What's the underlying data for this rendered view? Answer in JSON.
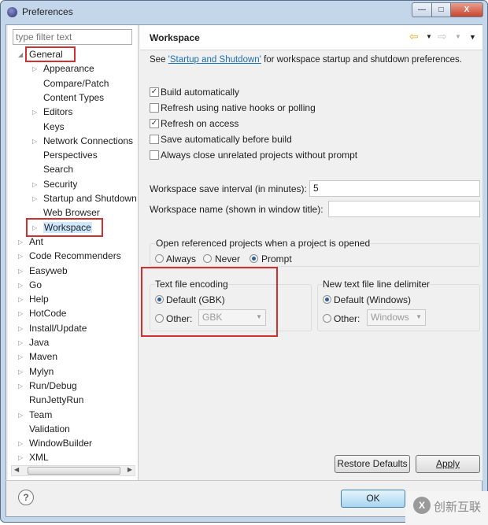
{
  "window": {
    "title": "Preferences",
    "minimize": "—",
    "maximize": "□",
    "close": "X"
  },
  "filter": {
    "placeholder": "type filter text"
  },
  "tree": [
    {
      "label": "General",
      "indent": 1,
      "arrow": "expanded"
    },
    {
      "label": "Appearance",
      "indent": 2,
      "arrow": "collapsed"
    },
    {
      "label": "Compare/Patch",
      "indent": 2,
      "arrow": "none"
    },
    {
      "label": "Content Types",
      "indent": 2,
      "arrow": "none"
    },
    {
      "label": "Editors",
      "indent": 2,
      "arrow": "collapsed"
    },
    {
      "label": "Keys",
      "indent": 2,
      "arrow": "none"
    },
    {
      "label": "Network Connections",
      "indent": 2,
      "arrow": "collapsed"
    },
    {
      "label": "Perspectives",
      "indent": 2,
      "arrow": "none"
    },
    {
      "label": "Search",
      "indent": 2,
      "arrow": "none"
    },
    {
      "label": "Security",
      "indent": 2,
      "arrow": "collapsed"
    },
    {
      "label": "Startup and Shutdown",
      "indent": 2,
      "arrow": "collapsed"
    },
    {
      "label": "Web Browser",
      "indent": 2,
      "arrow": "none"
    },
    {
      "label": "Workspace",
      "indent": 2,
      "arrow": "collapsed",
      "selected": true
    },
    {
      "label": "Ant",
      "indent": 1,
      "arrow": "collapsed"
    },
    {
      "label": "Code Recommenders",
      "indent": 1,
      "arrow": "collapsed"
    },
    {
      "label": "Easyweb",
      "indent": 1,
      "arrow": "collapsed"
    },
    {
      "label": "Go",
      "indent": 1,
      "arrow": "collapsed"
    },
    {
      "label": "Help",
      "indent": 1,
      "arrow": "collapsed"
    },
    {
      "label": "HotCode",
      "indent": 1,
      "arrow": "collapsed"
    },
    {
      "label": "Install/Update",
      "indent": 1,
      "arrow": "collapsed"
    },
    {
      "label": "Java",
      "indent": 1,
      "arrow": "collapsed"
    },
    {
      "label": "Maven",
      "indent": 1,
      "arrow": "collapsed"
    },
    {
      "label": "Mylyn",
      "indent": 1,
      "arrow": "collapsed"
    },
    {
      "label": "Run/Debug",
      "indent": 1,
      "arrow": "collapsed"
    },
    {
      "label": "RunJettyRun",
      "indent": 1,
      "arrow": "none"
    },
    {
      "label": "Team",
      "indent": 1,
      "arrow": "collapsed"
    },
    {
      "label": "Validation",
      "indent": 1,
      "arrow": "none"
    },
    {
      "label": "WindowBuilder",
      "indent": 1,
      "arrow": "collapsed"
    },
    {
      "label": "XML",
      "indent": 1,
      "arrow": "collapsed"
    }
  ],
  "page": {
    "title": "Workspace",
    "intro_pre": "See ",
    "intro_link": "'Startup and Shutdown'",
    "intro_post": " for workspace startup and shutdown preferences.",
    "checkboxes": [
      {
        "label": "Build automatically",
        "checked": true
      },
      {
        "label": "Refresh using native hooks or polling",
        "checked": false
      },
      {
        "label": "Refresh on access",
        "checked": true
      },
      {
        "label": "Save automatically before build",
        "checked": false
      },
      {
        "label": "Always close unrelated projects without prompt",
        "checked": false
      }
    ],
    "save_interval_label": "Workspace save interval (in minutes):",
    "save_interval_value": "5",
    "ws_name_label": "Workspace name (shown in window title):",
    "ws_name_value": "",
    "open_ref": {
      "label": "Open referenced projects when a project is opened",
      "options": [
        "Always",
        "Never",
        "Prompt"
      ],
      "selected": "Prompt"
    },
    "encoding": {
      "label": "Text file encoding",
      "default": "Default (GBK)",
      "other": "Other:",
      "other_value": "GBK",
      "selected": "Default"
    },
    "delimiter": {
      "label": "New text file line delimiter",
      "default": "Default (Windows)",
      "other": "Other:",
      "other_value": "Windows",
      "selected": "Default"
    },
    "restore": "Restore Defaults",
    "apply": "Apply"
  },
  "footer": {
    "help": "?",
    "ok": "OK"
  },
  "watermark": "创新互联",
  "colors": {
    "highlight": "#d03030",
    "link": "#1a6fb5",
    "selection": "#cde8ff"
  }
}
